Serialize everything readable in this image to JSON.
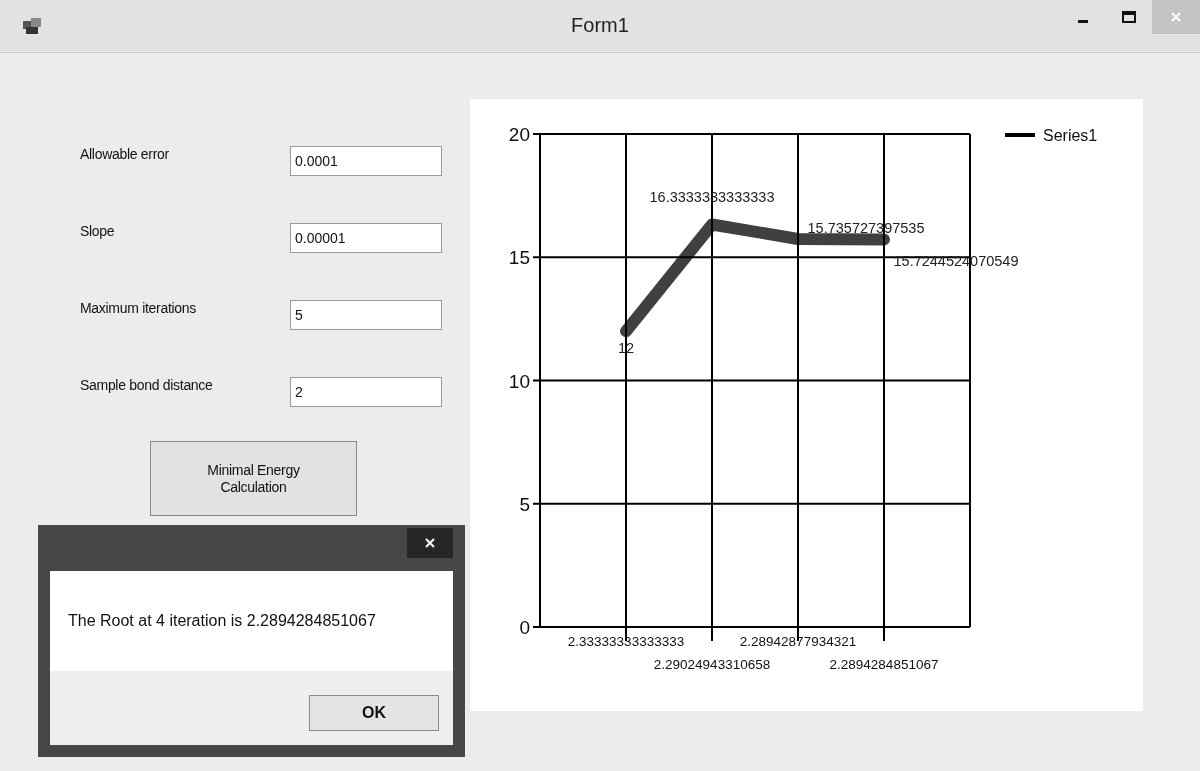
{
  "window": {
    "title": "Form1"
  },
  "fields": [
    {
      "label": "Allowable error",
      "value": "0.0001"
    },
    {
      "label": "Slope",
      "value": "0.00001"
    },
    {
      "label": "Maximum iterations",
      "value": "5"
    },
    {
      "label": "Sample bond distance",
      "value": "2"
    }
  ],
  "calculate_button": {
    "label": "Minimal Energy Calculation"
  },
  "chart": {
    "chart_data": {
      "type": "line",
      "categories": [
        "2.33333333333333",
        "2.29024943310658",
        "2.28942877934321",
        "2.2894284851067"
      ],
      "series": [
        {
          "name": "Series1",
          "color": "#000000",
          "values": [
            12,
            16.33,
            15.74,
            15.72
          ]
        }
      ],
      "ylim": [
        0,
        20
      ],
      "grid": true,
      "yticks": [
        0,
        5,
        10,
        15,
        20
      ],
      "value_labels": [
        "12",
        "16.3333333333333",
        "15.735727397535",
        "15.7244524070549"
      ]
    }
  },
  "message_box": {
    "text": "The Root at 4 iteration is 2.2894284851067",
    "button": "OK"
  }
}
